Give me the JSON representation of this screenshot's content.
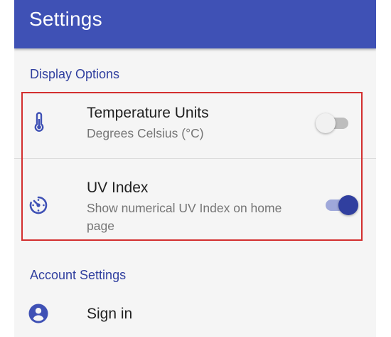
{
  "appbar": {
    "title": "Settings"
  },
  "sections": {
    "display": {
      "header": "Display Options",
      "temperature": {
        "title": "Temperature Units",
        "summary": "Degrees Celsius (°C)",
        "enabled": false,
        "icon": "thermometer-icon"
      },
      "uv": {
        "title": "UV Index",
        "summary": "Show numerical UV Index on home page",
        "enabled": true,
        "icon": "uv-index-icon"
      }
    },
    "account": {
      "header": "Account Settings",
      "signin": {
        "title": "Sign in",
        "icon": "account-circle-icon"
      }
    }
  },
  "colors": {
    "primary": "#3f51b5",
    "accent_dark": "#303f9f",
    "highlight_border": "#d32f2f"
  }
}
